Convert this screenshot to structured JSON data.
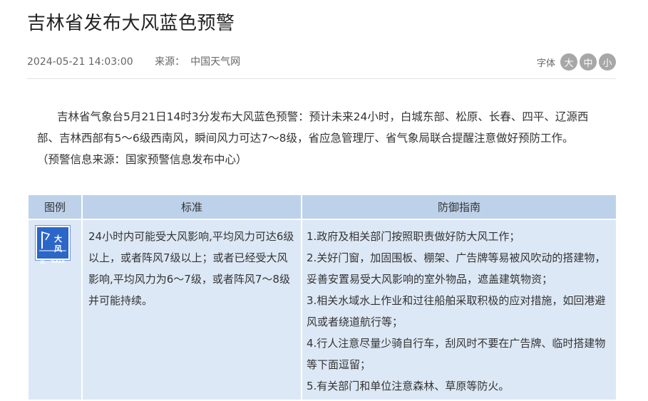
{
  "article": {
    "title": "吉林省发布大风蓝色预警",
    "date": "2024-05-21 14:03:00",
    "source_label": "来源：",
    "source_value": "中国天气网"
  },
  "font_size": {
    "label": "字体",
    "large": "大",
    "medium": "中",
    "small": "小"
  },
  "content": {
    "paragraph": "吉林省气象台5月21日14时3分发布大风蓝色预警：预计未来24小时，白城东部、松原、长春、四平、辽源西部、吉林西部有5～6级西南风，瞬间风力可达7～8级，省应急管理厅、省气象局联合提醒注意做好预防工作。",
    "source_note": "（预警信息来源：国家预警信息发布中心）"
  },
  "table": {
    "headers": [
      "图例",
      "标准",
      "防御指南"
    ],
    "legend_icon": {
      "name": "gale-blue-warning-icon",
      "text_top": "大",
      "text_bottom": "风",
      "level": "蓝",
      "english": "GALE",
      "color": "#2b66c9"
    },
    "standard": "24小时内可能受大风影响,平均风力可达6级以上，或者阵风7级以上；或者已经受大风影响,平均风力为6～7级，或者阵风7～8级并可能持续。",
    "guidelines": [
      "1.政府及相关部门按照职责做好防大风工作；",
      "2.关好门窗，加固围板、棚架、广告牌等易被风吹动的搭建物，妥善安置易受大风影响的室外物品，遮盖建筑物资；",
      "3.相关水域水上作业和过往船舶采取积极的应对措施，如回港避风或者绕道航行等；",
      "4.行人注意尽量少骑自行车，刮风时不要在广告牌、临时搭建物等下面逗留；",
      "5.有关部门和单位注意森林、草原等防火。"
    ]
  }
}
